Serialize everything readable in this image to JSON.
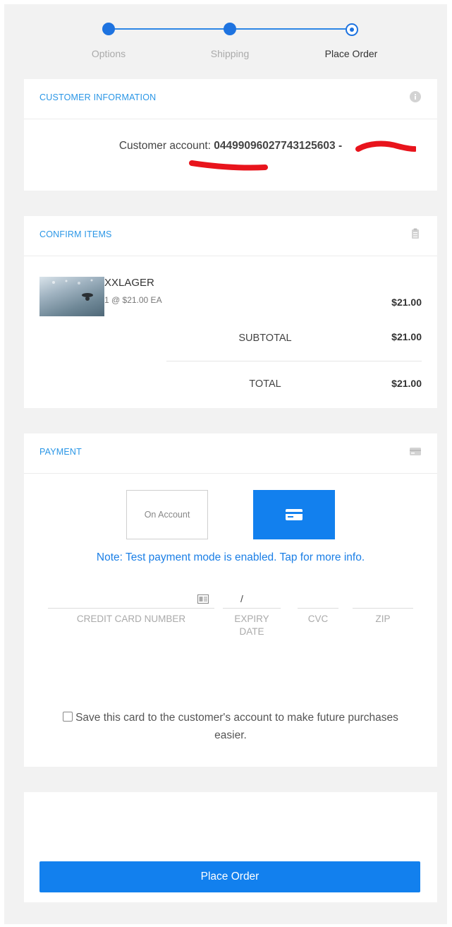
{
  "stepper": {
    "steps": [
      "Options",
      "Shipping",
      "Place Order"
    ],
    "current": 2
  },
  "customer": {
    "title": "CUSTOMER INFORMATION",
    "account_label": "Customer account:",
    "account_number": "04499096027743125603 -"
  },
  "items": {
    "title": "CONFIRM ITEMS",
    "list": [
      {
        "name": "XXLAGER",
        "qty_line": "1 @ $21.00 EA",
        "price": "$21.00"
      }
    ],
    "subtotal_label": "SUBTOTAL",
    "subtotal_value": "$21.00",
    "total_label": "TOTAL",
    "total_value": "$21.00"
  },
  "payment": {
    "title": "PAYMENT",
    "on_account_label": "On Account",
    "note": "Note: Test payment mode is enabled. Tap for more info.",
    "expiry_separator": "/",
    "fields": {
      "card_number": "CREDIT CARD NUMBER",
      "expiry": "EXPIRY DATE",
      "cvc": "CVC",
      "zip": "ZIP"
    },
    "save_card_text": "Save this card to the customer's account to make future purchases easier."
  },
  "order": {
    "place_order_label": "Place Order"
  },
  "colors": {
    "accent": "#1280ee",
    "title_blue": "#2a96e6",
    "background": "#f2f2f2"
  }
}
